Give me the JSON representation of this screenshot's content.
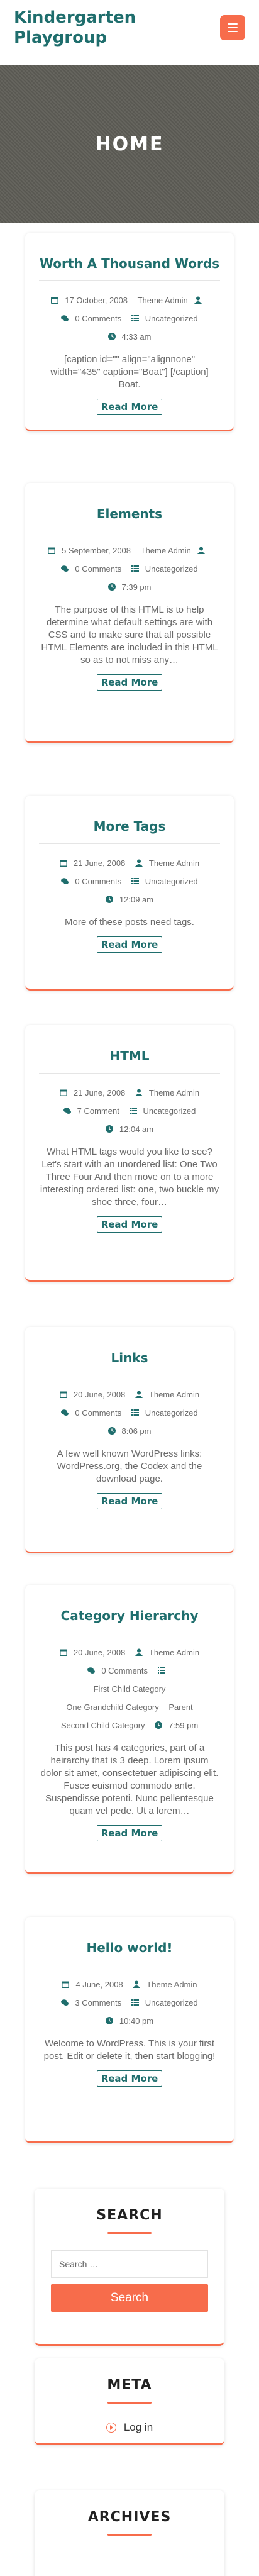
{
  "site": {
    "title": "Kindergarten Playgroup"
  },
  "hero": {
    "title": "HOME"
  },
  "posts": [
    {
      "title": "Worth A Thousand Words",
      "date": "17 October, 2008",
      "author": "Theme Admin",
      "comments": "0 Comments",
      "categories": "Uncategorized",
      "time": "4:33 am",
      "excerpt": "[caption id=\"\" align=\"alignnone\" width=\"435\" caption=\"Boat\"] [/caption] Boat.",
      "read_more": "Read More"
    },
    {
      "title": "Elements",
      "date": "5 September, 2008",
      "author": "Theme Admin",
      "comments": "0 Comments",
      "categories": "Uncategorized",
      "time": "7:39 pm",
      "excerpt": "The purpose of this HTML is to help determine what default settings are with CSS and to make sure that all possible HTML Elements are included in this HTML so as to not miss any…",
      "read_more": "Read More"
    },
    {
      "title": "More Tags",
      "date": "21 June, 2008",
      "author": "Theme Admin",
      "comments": "0 Comments",
      "categories": "Uncategorized",
      "time": "12:09 am",
      "excerpt": "More of these posts need tags.",
      "read_more": "Read More"
    },
    {
      "title": "HTML",
      "date": "21 June, 2008",
      "author": "Theme Admin",
      "comments": "7 Comment",
      "categories": "Uncategorized",
      "time": "12:04 am",
      "excerpt": "What HTML tags would you like to see? Let's start with an unordered list: One Two Three Four And then move on to a more interesting ordered list: one, two buckle my shoe three, four…",
      "read_more": "Read More"
    },
    {
      "title": "Links",
      "date": "20 June, 2008",
      "author": "Theme Admin",
      "comments": "0 Comments",
      "categories": "Uncategorized",
      "time": "8:06 pm",
      "excerpt": "A few well known WordPress links: WordPress.org, the Codex and the download page.",
      "read_more": "Read More"
    },
    {
      "title": "Category Hierarchy",
      "date": "20 June, 2008",
      "author": "Theme Admin",
      "comments": "0 Comments",
      "categories_list": [
        "First Child Category",
        "One Grandchild Category",
        "Parent",
        "Second Child Category"
      ],
      "time": "7:59 pm",
      "excerpt": "This post has 4 categories, part of a heirarchy that is 3 deep. Lorem ipsum dolor sit amet, consectetuer adipiscing elit. Fusce euismod commodo ante. Suspendisse potenti. Nunc pellentesque quam vel pede. Ut a lorem…",
      "read_more": "Read More"
    },
    {
      "title": "Hello world!",
      "date": "4 June, 2008",
      "author": "Theme Admin",
      "comments": "3 Comments",
      "categories": "Uncategorized",
      "time": "10:40 pm",
      "excerpt": "Welcome to WordPress. This is your first post. Edit or delete it, then start blogging!",
      "read_more": "Read More"
    }
  ],
  "search_widget": {
    "title": "SEARCH",
    "placeholder": "Search …",
    "button": "Search"
  },
  "meta_widget": {
    "title": "META",
    "login": "Log in"
  },
  "archives_widget": {
    "title": "ARCHIVES"
  },
  "colors": {
    "brand": "#1f6e6d",
    "accent": "#f76c4b"
  }
}
